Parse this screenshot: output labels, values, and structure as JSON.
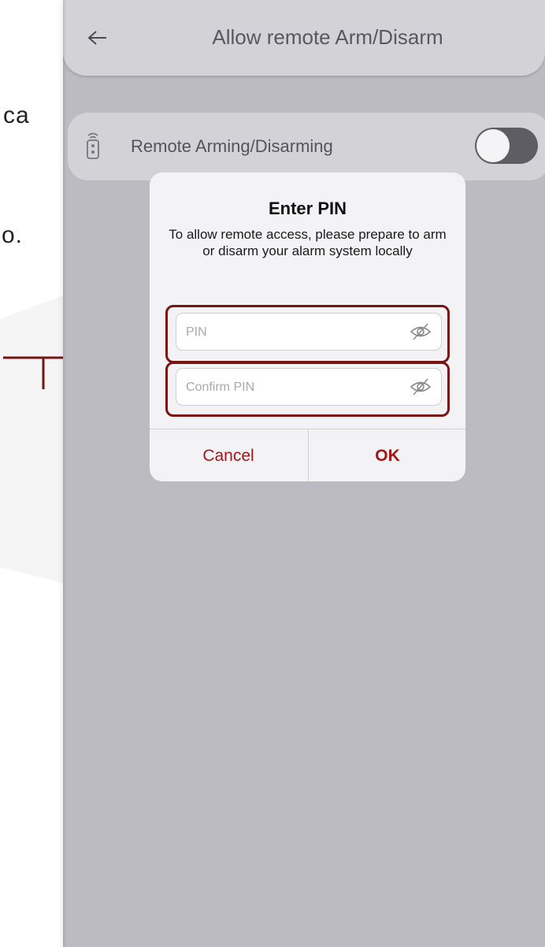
{
  "doc": {
    "fragment_1": "ca",
    "fragment_2": "o."
  },
  "header": {
    "back_icon": "arrow-left-icon",
    "title": "Allow remote Arm/Disarm"
  },
  "setting_row": {
    "icon": "remote-control-icon",
    "label": "Remote Arming/Disarming",
    "toggle_on": false
  },
  "dialog": {
    "title": "Enter PIN",
    "message": "To allow remote access, please prepare to arm or disarm your alarm system locally",
    "pin": {
      "value": "",
      "placeholder": "PIN",
      "icon": "eye-slash-icon"
    },
    "confirm_pin": {
      "value": "",
      "placeholder": "Confirm PIN",
      "icon": "eye-slash-icon"
    },
    "cancel_label": "Cancel",
    "ok_label": "OK"
  },
  "colors": {
    "accent": "#a5161b",
    "highlight": "#7a1313",
    "screen_bg": "#bcbbc1",
    "card_bg": "#d3d2d6"
  }
}
